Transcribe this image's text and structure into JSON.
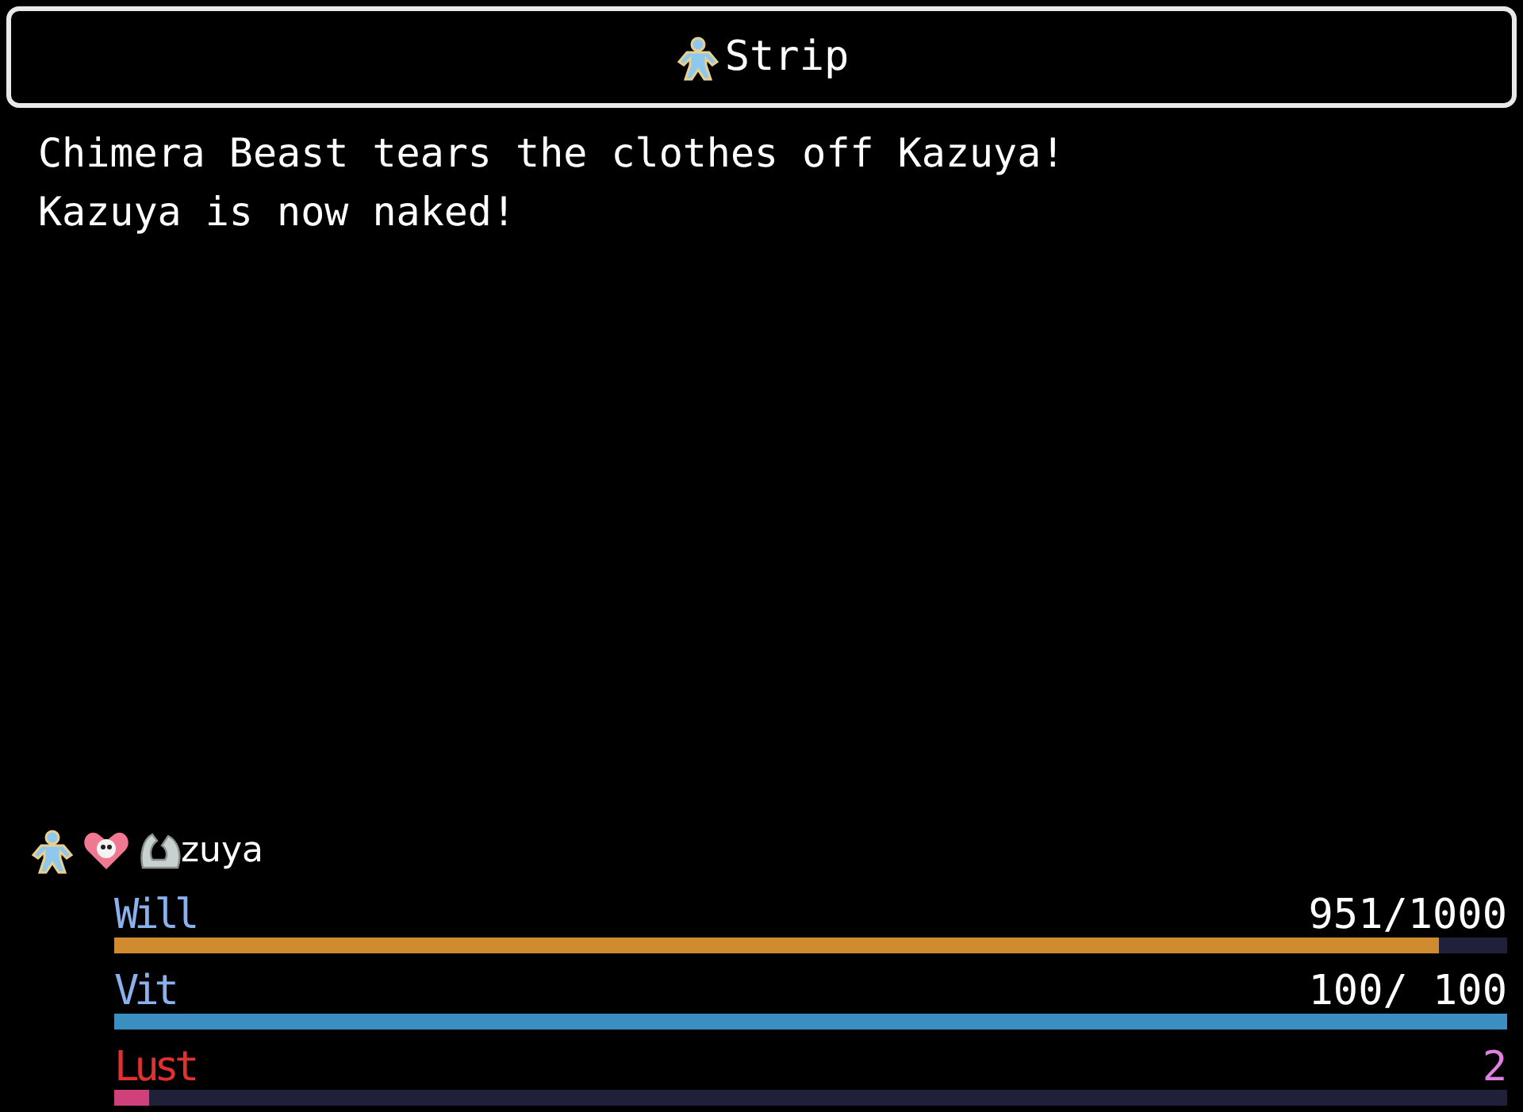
{
  "title": {
    "text": "Strip"
  },
  "messages": [
    "Chimera Beast tears the clothes off Kazuya!",
    "Kazuya is now naked!"
  ],
  "actor": {
    "name": "zuya",
    "gauges": [
      {
        "label": "Will",
        "reading": "951/1000",
        "level": 0.951,
        "color": "#d08a30"
      },
      {
        "label": "Vit",
        "reading": "100/ 100",
        "level": 1.0,
        "color": "#3a8fc0"
      },
      {
        "label": "Lust",
        "reading": "2",
        "level": 0.025,
        "color": "#d0407a"
      }
    ]
  }
}
